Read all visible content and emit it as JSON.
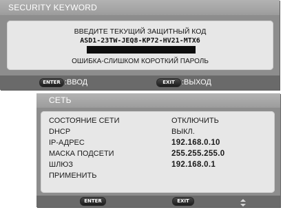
{
  "security_dialog": {
    "title": "SECURITY KEYWORD",
    "prompt": "ВВЕДИТЕ ТЕКУЩИЙ ЗАЩИТНЫЙ КОД",
    "code": "ASD1-23TW-JEQ8-KP72-HV21-MTX6",
    "input_value": "",
    "error": "ОШИБКА-СЛИШКОМ КОРОТКИЙ ПАРОЛЬ",
    "footer": {
      "enter_key": "ENTER",
      "enter_label": ":ВВОД",
      "exit_key": "EXIT",
      "exit_label": ":ВЫХОД"
    }
  },
  "network_menu": {
    "title": "СЕТЬ",
    "rows": [
      {
        "label": "СОСТОЯНИЕ СЕТИ",
        "value": "ОТКЛЮЧИТЬ"
      },
      {
        "label": "DHCP",
        "value": "ВЫКЛ."
      },
      {
        "label": "IP-АДРЕС",
        "value": "192.168.0.10"
      },
      {
        "label": "МАСКА ПОДСЕТИ",
        "value": "255.255.255.0"
      },
      {
        "label": "ШЛЮЗ",
        "value": "192.168.0.1"
      },
      {
        "label": "ПРИМЕНИТЬ",
        "value": ""
      }
    ],
    "footer": {
      "enter_key": "ENTER",
      "exit_key": "EXIT",
      "nav_icon": "up-down-arrows-icon"
    }
  }
}
